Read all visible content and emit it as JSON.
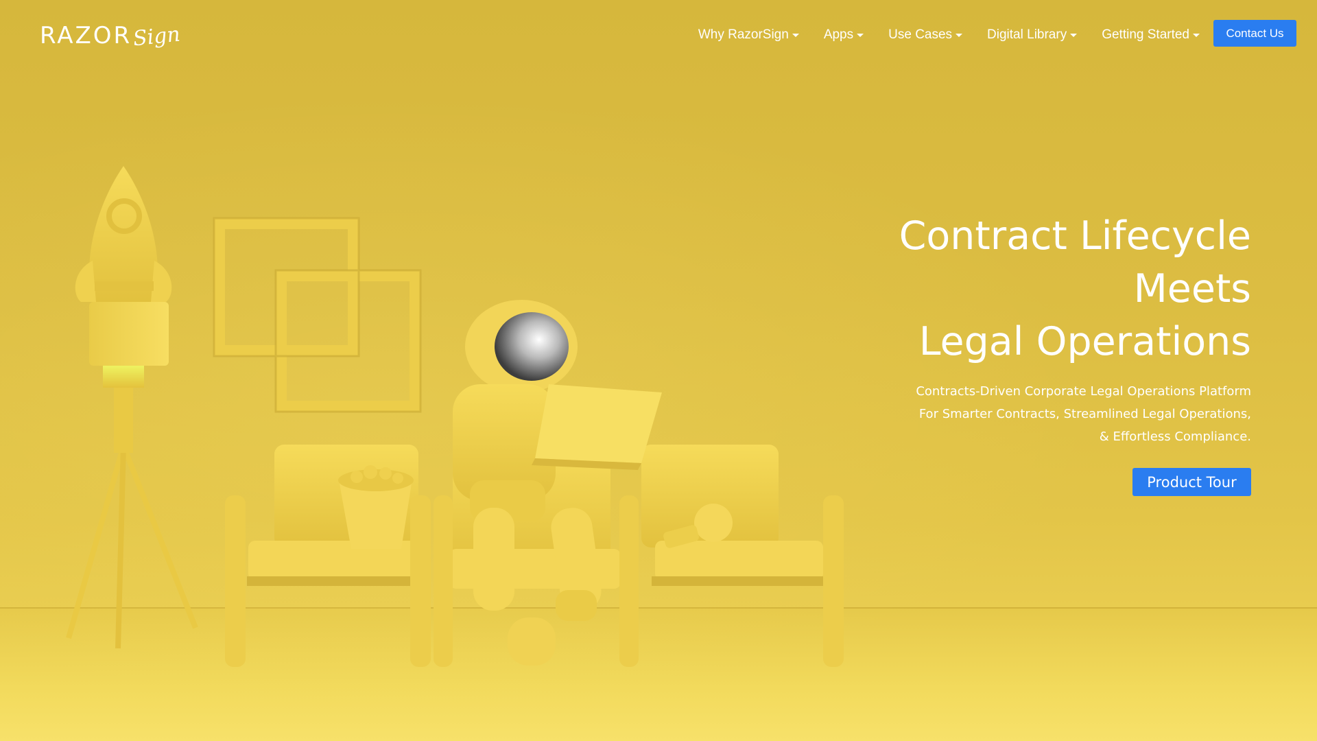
{
  "header": {
    "logo_text": "RAZOR",
    "logo_script": "Sign",
    "nav": [
      {
        "label": "Why RazorSign"
      },
      {
        "label": "Apps"
      },
      {
        "label": "Use Cases"
      },
      {
        "label": "Digital Library"
      },
      {
        "label": "Getting Started"
      }
    ],
    "contact_label": "Contact Us"
  },
  "hero": {
    "title_lines": [
      "Contract Lifecycle",
      "Meets",
      "Legal Operations"
    ],
    "subtitle_lines": [
      "Contracts-Driven Corporate Legal Operations Platform",
      "For Smarter Contracts, Streamlined Legal Operations,",
      "& Effortless Compliance."
    ],
    "cta_label": "Product Tour"
  },
  "colors": {
    "background": "#dcbd42",
    "accent_button": "#2a7df0",
    "text": "#ffffff"
  }
}
